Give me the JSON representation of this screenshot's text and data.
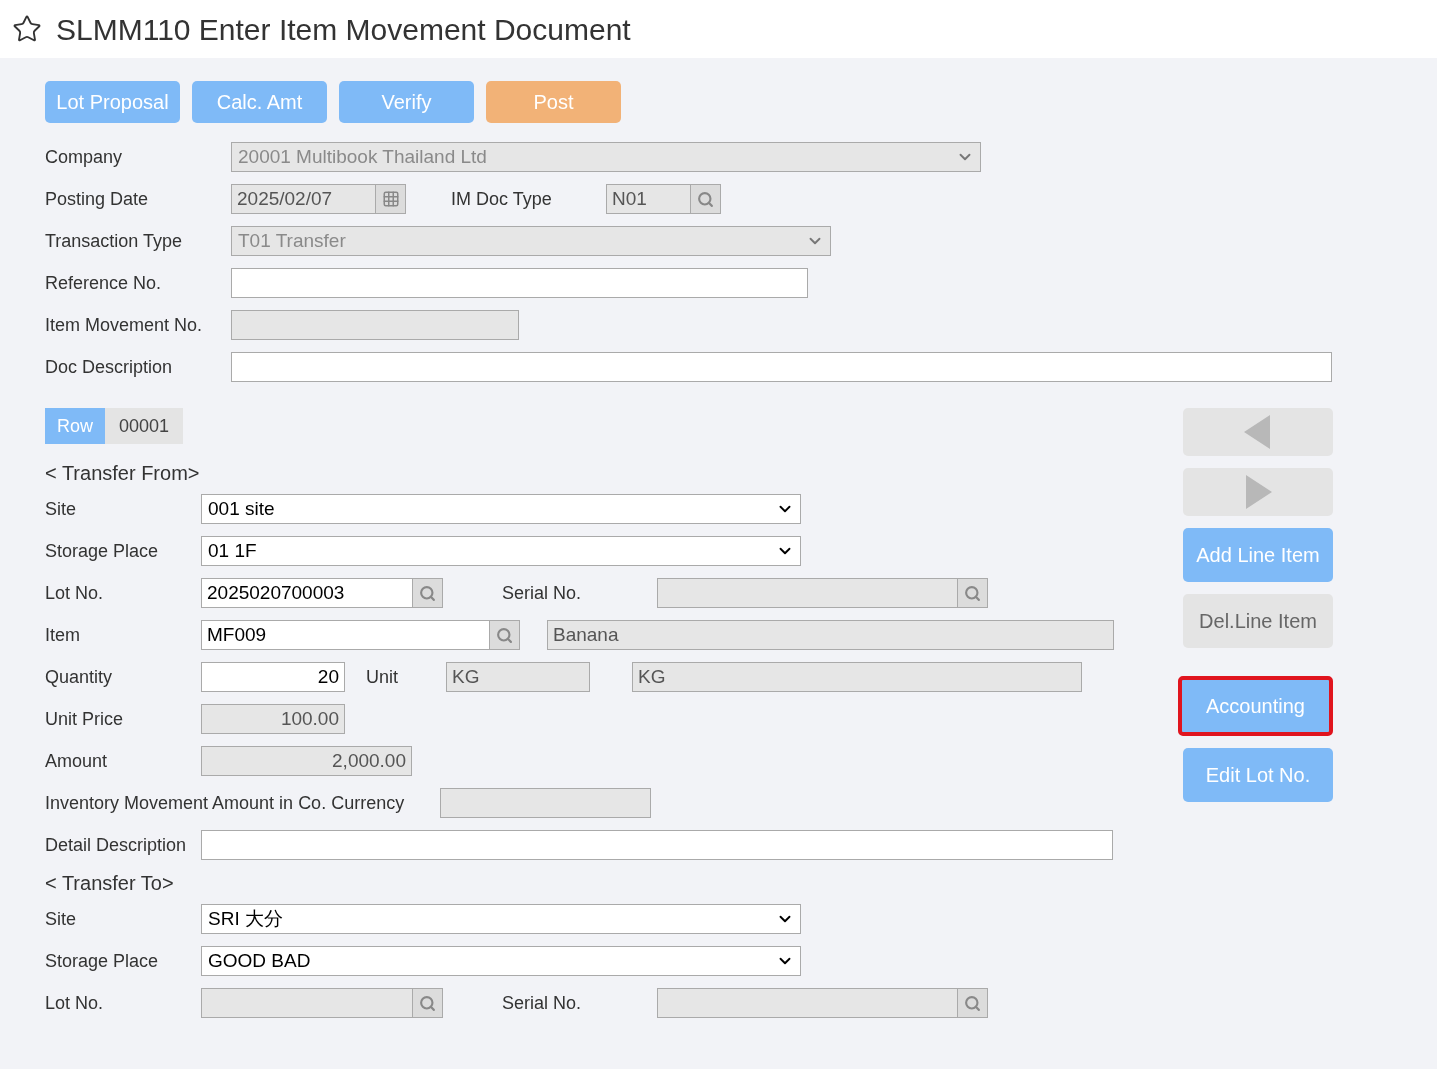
{
  "header": {
    "title": "SLMM110 Enter Item Movement Document",
    "favorite": false
  },
  "toolbar": [
    {
      "label": "Lot Proposal",
      "kind": "primary"
    },
    {
      "label": "Calc. Amt",
      "kind": "primary"
    },
    {
      "label": "Verify",
      "kind": "primary"
    },
    {
      "label": "Post",
      "kind": "post"
    }
  ],
  "form": {
    "company": {
      "label": "Company",
      "value": "20001 Multibook Thailand Ltd",
      "disabled": true
    },
    "posting_date": {
      "label": "Posting Date",
      "value": "2025/02/07",
      "disabled": true
    },
    "im_doc_type": {
      "label": "IM Doc Type",
      "value": "N01",
      "disabled": true
    },
    "transaction_type": {
      "label": "Transaction Type",
      "value": "T01 Transfer",
      "disabled": true
    },
    "reference_no": {
      "label": "Reference No.",
      "disabled": false
    },
    "item_movement_no": {
      "label": "Item Movement No.",
      "disabled": true
    },
    "doc_description": {
      "label": "Doc Description",
      "disabled": false
    }
  },
  "row_indicator": {
    "label": "Row",
    "value": "00001"
  },
  "transfer_from": {
    "heading": "< Transfer From>",
    "site": {
      "label": "Site",
      "value": "001 site"
    },
    "storage_place": {
      "label": "Storage Place",
      "value": "01 1F"
    },
    "lot_no": {
      "label": "Lot No.",
      "value": "2025020700003",
      "disabled": false
    },
    "serial_no": {
      "label": "Serial No.",
      "disabled": true
    },
    "item": {
      "label": "Item",
      "value": "MF009",
      "name": "Banana"
    },
    "quantity": {
      "label": "Quantity",
      "value": "20"
    },
    "unit": {
      "label": "Unit",
      "value": "KG",
      "name": "KG"
    },
    "unit_price": {
      "label": "Unit Price",
      "value": "100.00"
    },
    "amount": {
      "label": "Amount",
      "value": "2,000.00"
    },
    "co_currency_amount": {
      "label": "Inventory Movement Amount in Co. Currency"
    },
    "detail_description": {
      "label": "Detail Description"
    }
  },
  "transfer_to": {
    "heading": "< Transfer To>",
    "site": {
      "label": "Site",
      "value": "SRI 大分"
    },
    "storage_place": {
      "label": "Storage Place",
      "value": "GOOD BAD"
    },
    "lot_no": {
      "label": "Lot No.",
      "disabled": true
    },
    "serial_no": {
      "label": "Serial No.",
      "disabled": true
    }
  },
  "side_buttons": [
    {
      "kind": "prev",
      "disabled": true
    },
    {
      "kind": "next",
      "disabled": true
    },
    {
      "kind": "text",
      "label": "Add Line Item",
      "disabled": false,
      "highlighted": false
    },
    {
      "kind": "text",
      "label": "Del.Line Item",
      "disabled": true,
      "highlighted": false
    },
    {
      "kind": "text",
      "label": "Accounting",
      "disabled": false,
      "highlighted": true
    },
    {
      "kind": "text",
      "label": "Edit Lot No.",
      "disabled": false,
      "highlighted": false
    }
  ]
}
